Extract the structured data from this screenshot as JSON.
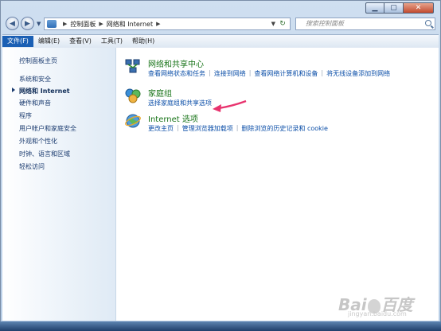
{
  "window": {
    "controls": {
      "minimize": "▁",
      "maximize": "▢",
      "close": "✕"
    }
  },
  "address": {
    "crumbs": [
      "控制面板",
      "网络和 Internet"
    ],
    "search_placeholder": "搜索控制面板"
  },
  "menubar": {
    "items": [
      "文件(F)",
      "编辑(E)",
      "查看(V)",
      "工具(T)",
      "帮助(H)"
    ]
  },
  "sidebar": {
    "items": [
      "控制面板主页",
      "系统和安全",
      "网络和 Internet",
      "硬件和声音",
      "程序",
      "用户帐户和家庭安全",
      "外观和个性化",
      "时钟、语言和区域",
      "轻松访问"
    ]
  },
  "sections": [
    {
      "title": "网络和共享中心",
      "links": [
        "查看网络状态和任务",
        "连接到网络",
        "查看网络计算机和设备",
        "将无线设备添加到网络"
      ]
    },
    {
      "title": "家庭组",
      "links": [
        "选择家庭组和共享选项"
      ]
    },
    {
      "title": "Internet 选项",
      "links": [
        "更改主页",
        "管理浏览器加载项",
        "删除浏览的历史记录和 cookie"
      ]
    }
  ],
  "colors": {
    "annotation_arrow": "#e8336e",
    "link": "#0c4fa8",
    "section_title": "#177317"
  },
  "watermark": {
    "main": "Bai",
    "tail": "百度",
    "sub": "jingyan.baidu.com"
  }
}
